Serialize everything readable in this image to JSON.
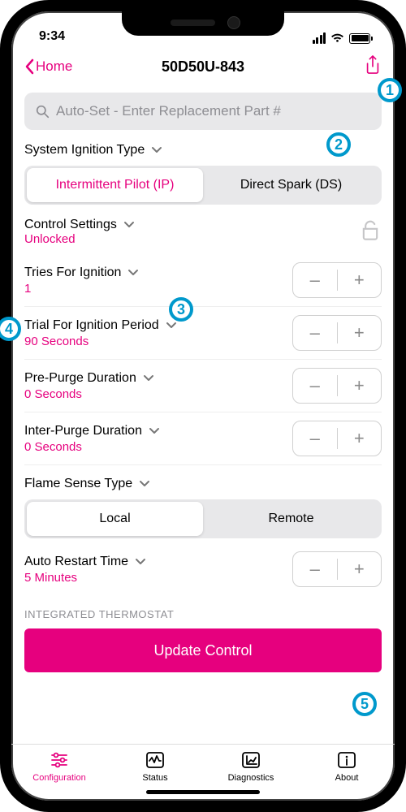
{
  "statusbar": {
    "time": "9:34"
  },
  "nav": {
    "back_label": "Home",
    "title": "50D50U-843"
  },
  "search": {
    "placeholder": "Auto-Set - Enter Replacement Part #"
  },
  "ignition_type": {
    "label": "System Ignition Type",
    "option_ip": "Intermittent Pilot (IP)",
    "option_ds": "Direct Spark (DS)"
  },
  "control_settings": {
    "label": "Control Settings",
    "value": "Unlocked"
  },
  "rows": {
    "tries": {
      "label": "Tries For Ignition",
      "value": "1"
    },
    "trial": {
      "label": "Trial For Ignition Period",
      "value": "90 Seconds"
    },
    "prepurge": {
      "label": "Pre-Purge Duration",
      "value": "0 Seconds"
    },
    "interpurge": {
      "label": "Inter-Purge Duration",
      "value": "0 Seconds"
    },
    "restart": {
      "label": "Auto Restart Time",
      "value": "5 Minutes"
    }
  },
  "flame_sense": {
    "label": "Flame Sense Type",
    "option_local": "Local",
    "option_remote": "Remote"
  },
  "group_label": "INTEGRATED THERMOSTAT",
  "update_label": "Update Control",
  "tabs": {
    "config": "Configuration",
    "status": "Status",
    "diag": "Diagnostics",
    "about": "About"
  },
  "annotations": {
    "a1": "1",
    "a2": "2",
    "a3": "3",
    "a4": "4",
    "a5": "5"
  }
}
